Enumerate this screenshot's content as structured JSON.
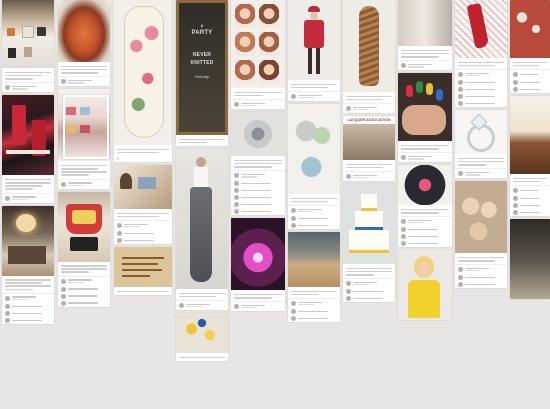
{
  "board": {
    "chalk_sign": [
      "A",
      "PARTY",
      "NEVER",
      "KNITTED",
      "Holiday"
    ],
    "wordart_heading": "LACQUER ASSOCIATION"
  },
  "colors": {
    "background": "#e7e6e4",
    "card": "#ffffff",
    "pin_red": "#d9323b",
    "text_gray": "#555555"
  }
}
